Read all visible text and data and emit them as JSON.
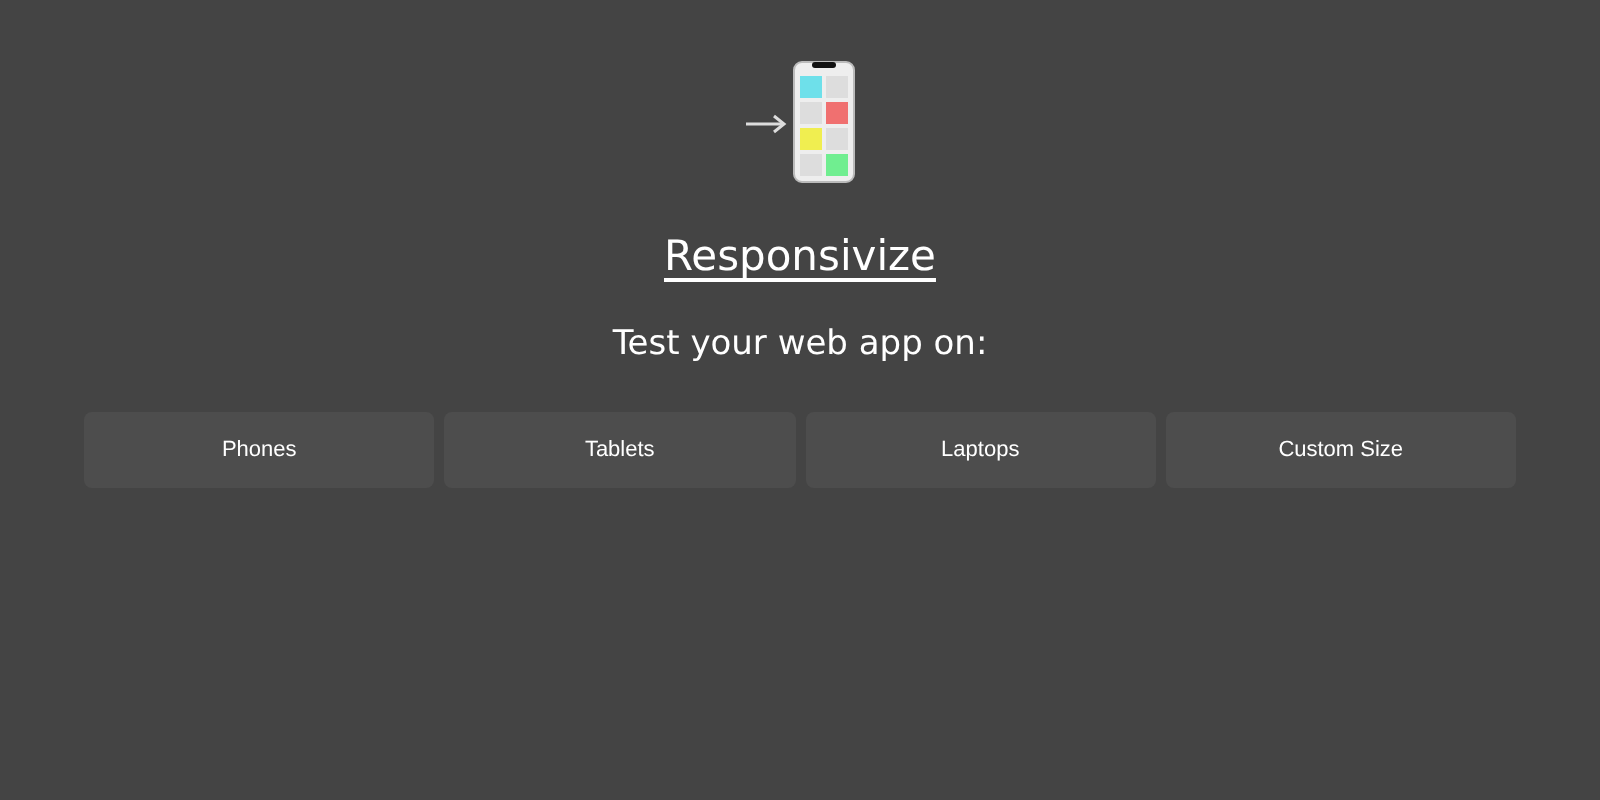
{
  "title": "Responsivize",
  "subtitle": "Test your web app on:",
  "device_buttons": [
    {
      "label": "Phones"
    },
    {
      "label": "Tablets"
    },
    {
      "label": "Laptops"
    },
    {
      "label": "Custom Size"
    }
  ]
}
